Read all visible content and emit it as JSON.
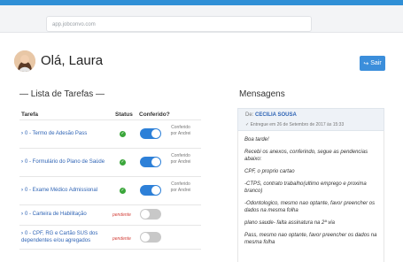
{
  "browser": {
    "url": "app.jobconvo.com"
  },
  "header": {
    "greeting": "Olá, Laura",
    "logout_label": "Sair"
  },
  "tasks": {
    "title": "— Lista de Tarefas —",
    "columns": {
      "task": "Tarefa",
      "status": "Status",
      "checked": "Conferido?"
    },
    "rows": [
      {
        "label": "0 - Termo de Adesão Pass",
        "status": "ok",
        "toggle": "on",
        "checked_by": "Conferido por Andrei"
      },
      {
        "label": "0 - Formulário do Plano de Saúde",
        "status": "ok",
        "toggle": "on",
        "checked_by": "Conferido por Andrei"
      },
      {
        "label": "0 - Exame Médico Admissional",
        "status": "ok",
        "toggle": "on",
        "checked_by": "Conferido por Andrei"
      },
      {
        "label": "0 - Carteira de Habilitação",
        "status": "pendente",
        "toggle": "off",
        "checked_by": ""
      },
      {
        "label": "0 - CPF, RG e Cartão SUS dos dependentes e/ou agregados",
        "status": "pendente",
        "toggle": "off",
        "checked_by": ""
      }
    ]
  },
  "messages": {
    "title": "Mensagens",
    "from_prefix": "De:",
    "from": "CECILIA SOUSA",
    "date": "Entregue em 26 de Setembro de 2017 às 15:33",
    "lines": [
      "Boa tarde!",
      "Recebi os anexos, conferindo, segue as pendencias abaixo:",
      "CPF, o proprio cartao",
      "-CTPS, contrato trabalho(ultimo emprego e proxima branco)",
      "-Odontologico, mesmo nao optante, favor preencher os dados na mesma folha",
      "plano saude- falta assinatura na 2ª via",
      "Pass, mesmo nao optante, favor preencher os dados na mesma folha"
    ]
  },
  "colors": {
    "accent": "#2d80d8",
    "pending": "#d3423b",
    "ok": "#3aa63a"
  }
}
